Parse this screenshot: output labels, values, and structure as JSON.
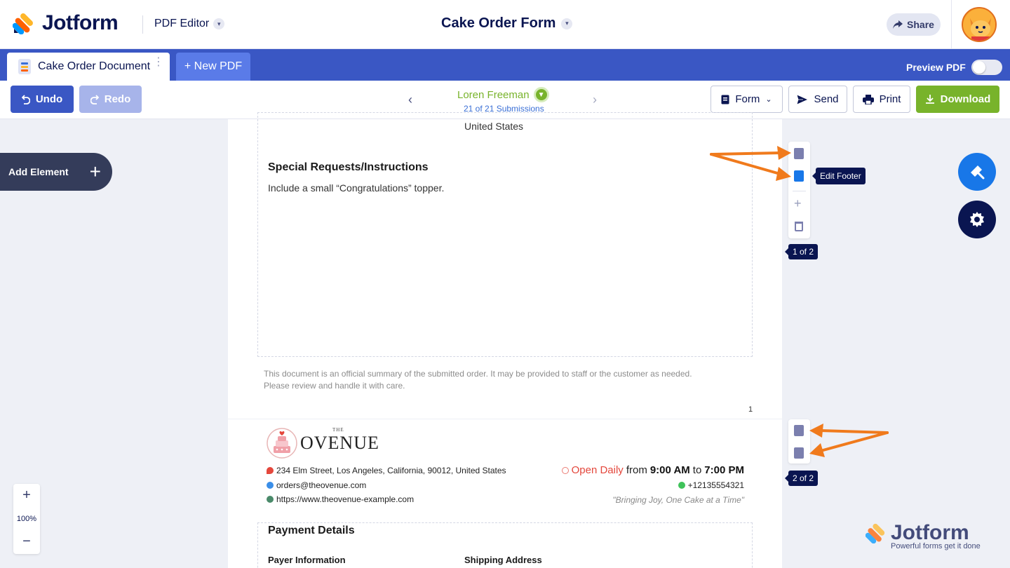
{
  "header": {
    "brand": "Jotform",
    "product": "PDF Editor",
    "form_title": "Cake Order Form",
    "share_label": "Share"
  },
  "tabs": {
    "active_label": "Cake Order Document",
    "new_label": "+ New PDF",
    "preview_label": "Preview PDF",
    "preview_on": false
  },
  "toolbar": {
    "undo": "Undo",
    "redo": "Redo",
    "submitter": "Loren Freeman",
    "submission_count": "21 of 21 Submissions",
    "form_menu": "Form",
    "send": "Send",
    "print": "Print",
    "download": "Download"
  },
  "left_panel": {
    "add_element": "Add Element",
    "zoom": "100%"
  },
  "page1": {
    "shipping_fragment": "United States",
    "special_title": "Special Requests/Instructions",
    "special_text": "Include a small “Congratulations” topper.",
    "footer_line1": "This document is an official summary of the submitted order. It may be provided to staff or the customer as needed.",
    "footer_line2": "Please review and handle it with care.",
    "page_number": "1"
  },
  "page2": {
    "logo_the": "THE",
    "logo_name": "OVENUE",
    "address": "234 Elm Street, Los Angeles, California, 90012, United States",
    "email": "orders@theovenue.com",
    "website": "https://www.theovenue-example.com",
    "hours_prefix": "Open Daily",
    "hours_from": "from",
    "hours_open": "9:00 AM",
    "hours_to": "to",
    "hours_close": "7:00 PM",
    "phone": "+12135554321",
    "motto": "\"Bringing Joy, One Cake at a Time\"",
    "payment_title": "Payment Details",
    "payer_label": "Payer Information",
    "shipping_label": "Shipping Address"
  },
  "page_tools": {
    "tooltip": "Edit Footer",
    "page1_badge": "1 of 2",
    "page2_badge": "2 of 2"
  },
  "watermark": {
    "brand": "Jotform",
    "tagline": "Powerful forms get it done"
  },
  "colors": {
    "primary": "#3a57c4",
    "accent_green": "#78b32b",
    "navy": "#0a1551",
    "annotation_arrow": "#f07a1c"
  }
}
